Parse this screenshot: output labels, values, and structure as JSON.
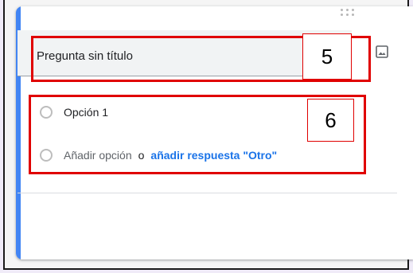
{
  "question": {
    "title": "Pregunta sin título"
  },
  "options": {
    "items": [
      {
        "label": "Opción 1"
      }
    ],
    "add_option_label": "Añadir opción",
    "or_text": "o",
    "add_other_label": "añadir respuesta \"Otro\""
  },
  "annotations": [
    {
      "number": "5"
    },
    {
      "number": "6"
    }
  ],
  "colors": {
    "accent": "#4285f4",
    "link": "#1a73e8",
    "annotation": "#e00000"
  },
  "icons": {
    "drag": "drag-handle-icon",
    "image": "image-icon",
    "radio": "radio-button-icon"
  }
}
